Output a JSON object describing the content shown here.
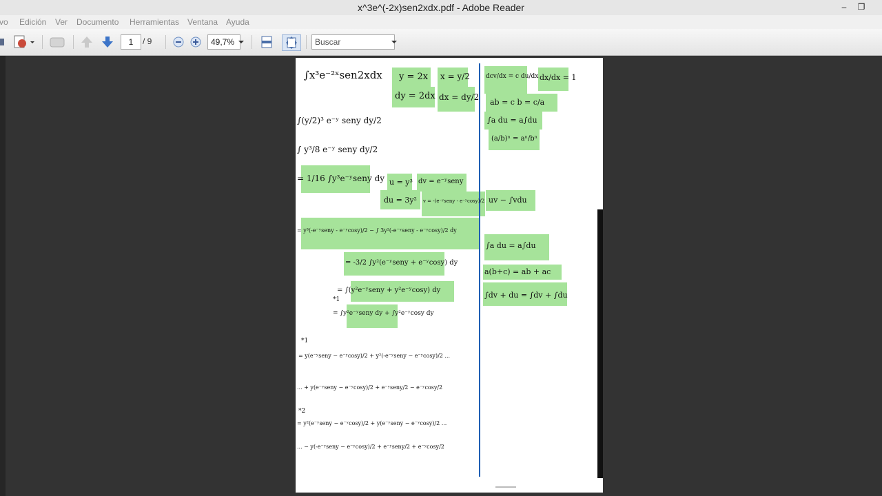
{
  "window": {
    "title": "x^3e^(-2x)sen2xdx.pdf - Adobe Reader",
    "minimize": "–",
    "restore": "❐"
  },
  "menu": [
    "vo",
    "Edición",
    "Ver",
    "Documento",
    "Herramientas",
    "Ventana",
    "Ayuda"
  ],
  "toolbar": {
    "page_current": "1",
    "page_total": "/ 9",
    "zoom": "49,7%",
    "search_placeholder": "Buscar"
  },
  "document": {
    "left_lines": [
      "∫x³e⁻²ˣsen2xdx",
      "∫(y/2)³ e⁻ʸ seny dy/2",
      "∫ y³/8 e⁻ʸ seny dy/2",
      "= 1/16 ∫y³e⁻ʸseny dy",
      "= y³(-e⁻ʸseny - e⁻ʸcosy)/2 − ∫ 3y²(-e⁻ʸseny - e⁻ʸcosy)/2 dy",
      "= -3/2 ∫y²(e⁻ʸseny + e⁻ʸcosy) dy",
      "= ∫(y²e⁻ʸseny + y²e⁻ʸcosy) dy",
      "= ∫y²e⁻ʸseny dy + ∫y²e⁻ʸcosy dy",
      "= y(e⁻ʸseny − e⁻ʸcosy)/2 + y²(-e⁻ʸseny − e⁻ʸcosy)/2 ...",
      "... + y(e⁻ʸseny − e⁻ʸcosy)/2 + e⁻ʸseny/2 − e⁻ʸcosy/2",
      "= y²(e⁻ʸseny − e⁻ʸcosy)/2 + y(e⁻ʸseny − e⁻ʸcosy)/2 ...",
      "... − y(-e⁻ʸseny − e⁻ʸcosy)/2 + e⁻ʸseny/2 + e⁻ʸcosy/2"
    ],
    "subs": [
      "y = 2x",
      "x = y/2",
      "dy = 2dx",
      "dx = dy/2"
    ],
    "parts": [
      "u = y³",
      "dv = e⁻ʸseny",
      "du = 3y²",
      "v = -(e⁻ʸseny - e⁻ʸcosy)/2"
    ],
    "marks": [
      "*1",
      "*2"
    ],
    "right_rules": [
      "dcv/dx = c du/dx",
      "dx/dx = 1",
      "ab = c   b = c/a",
      "∫a du = a∫du",
      "(a/b)ⁿ = aⁿ/bⁿ",
      "uv − ∫vdu",
      "∫a du = a∫du",
      "a(b+c) = ab + ac",
      "∫dv + du = ∫dv + ∫du"
    ]
  }
}
